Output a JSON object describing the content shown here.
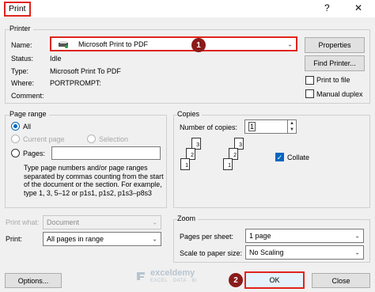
{
  "window": {
    "title": "Print",
    "help": "?",
    "close": "✕"
  },
  "printer": {
    "group_label": "Printer",
    "name_label": "Name:",
    "name_value": "Microsoft Print to PDF",
    "status_label": "Status:",
    "status_value": "Idle",
    "type_label": "Type:",
    "type_value": "Microsoft Print To PDF",
    "where_label": "Where:",
    "where_value": "PORTPROMPT:",
    "comment_label": "Comment:",
    "properties_button": "Properties",
    "find_printer_button": "Find Printer...",
    "print_to_file": "Print to file",
    "manual_duplex": "Manual duplex"
  },
  "page_range": {
    "group_label": "Page range",
    "all": "All",
    "current_page": "Current page",
    "selection": "Selection",
    "pages": "Pages:",
    "help_text": "Type page numbers and/or page ranges separated by commas counting from the start of the document or the section. For example, type 1, 3, 5–12 or p1s1, p1s2, p1s3–p8s3"
  },
  "copies": {
    "group_label": "Copies",
    "number_label": "Number of copies:",
    "number_value": "1",
    "collate": "Collate",
    "collate_checked": true,
    "stack_pages": [
      "3",
      "2",
      "1"
    ]
  },
  "print_what": {
    "label": "Print what:",
    "value": "Document"
  },
  "print": {
    "label": "Print:",
    "value": "All pages in range"
  },
  "zoom": {
    "group_label": "Zoom",
    "pages_per_sheet_label": "Pages per sheet:",
    "pages_per_sheet_value": "1 page",
    "scale_label": "Scale to paper size:",
    "scale_value": "No Scaling"
  },
  "footer": {
    "options_button": "Options...",
    "ok_button": "OK",
    "close_button": "Close",
    "watermark_name": "exceldemy",
    "watermark_tagline": "EXCEL · DATA · BI"
  },
  "callouts": [
    "1",
    "2"
  ],
  "colors": {
    "highlight": "#e0241b",
    "callout": "#8b1b1b",
    "accent": "#0067c0"
  }
}
